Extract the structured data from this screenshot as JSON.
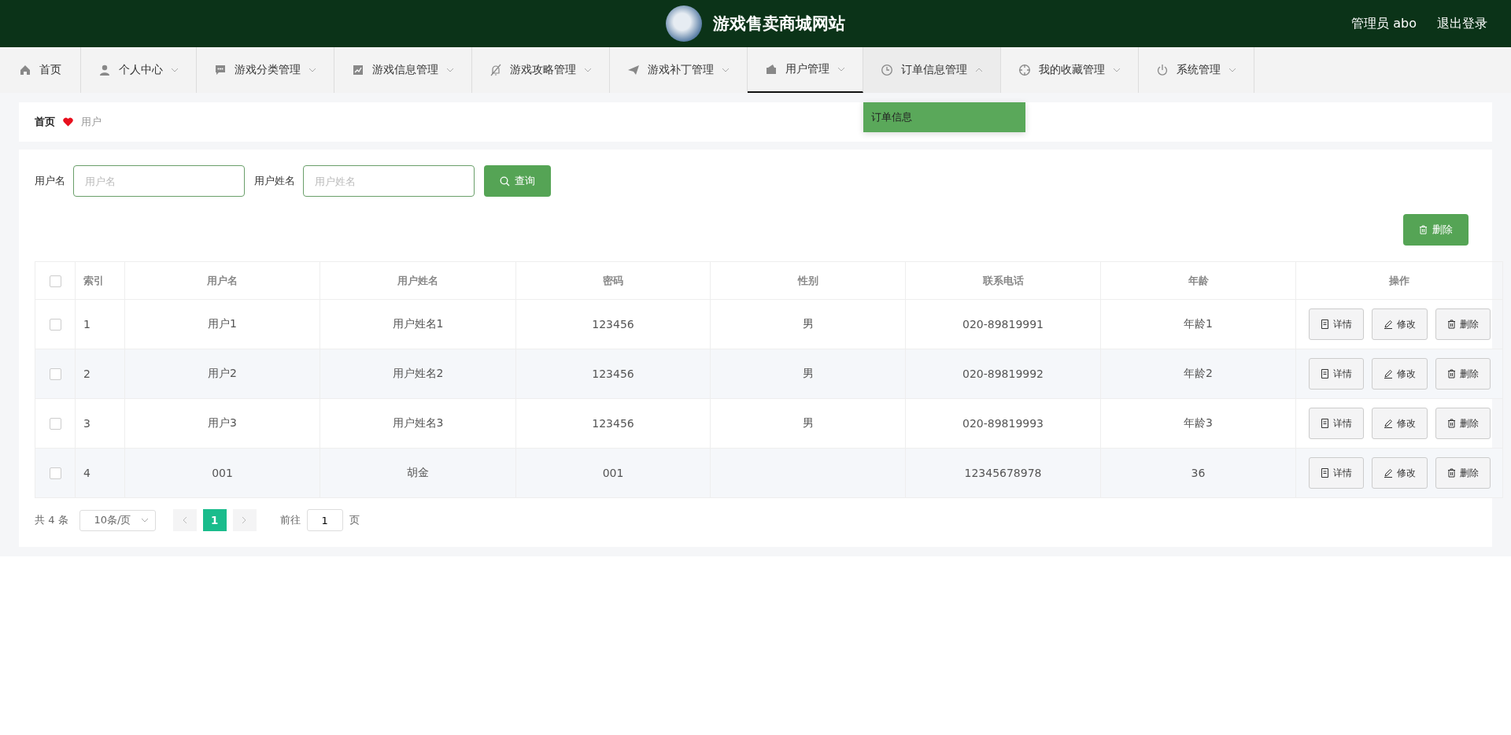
{
  "header": {
    "title": "游戏售卖商城网站",
    "user": "管理员 abo",
    "logout": "退出登录"
  },
  "nav": [
    {
      "label": "首页",
      "kind": "link",
      "selected": false
    },
    {
      "label": "个人中心",
      "kind": "dropdown",
      "selected": false,
      "expanded": false
    },
    {
      "label": "游戏分类管理",
      "kind": "dropdown",
      "selected": false,
      "expanded": false
    },
    {
      "label": "游戏信息管理",
      "kind": "dropdown",
      "selected": false,
      "expanded": false
    },
    {
      "label": "游戏攻略管理",
      "kind": "dropdown",
      "selected": false,
      "expanded": false
    },
    {
      "label": "游戏补丁管理",
      "kind": "dropdown",
      "selected": false,
      "expanded": false
    },
    {
      "label": "用户管理",
      "kind": "dropdown",
      "selected": true,
      "expanded": false
    },
    {
      "label": "订单信息管理",
      "kind": "dropdown",
      "selected": false,
      "expanded": true,
      "submenu": [
        "订单信息"
      ]
    },
    {
      "label": "我的收藏管理",
      "kind": "dropdown",
      "selected": false,
      "expanded": false
    },
    {
      "label": "系统管理",
      "kind": "dropdown",
      "selected": false,
      "expanded": false
    }
  ],
  "breadcrumb": [
    "首页",
    "用户"
  ],
  "search": {
    "fields": [
      {
        "label": "用户名",
        "placeholder": "用户名"
      },
      {
        "label": "用户姓名",
        "placeholder": "用户姓名"
      }
    ],
    "button": "查询"
  },
  "delete_button": "删除",
  "table": {
    "all_checked": false,
    "columns": [
      "索引",
      "用户名",
      "用户姓名",
      "密码",
      "性别",
      "联系电话",
      "年龄",
      "操作"
    ],
    "rows": [
      {
        "checked": false,
        "cells": [
          "1",
          "用户1",
          "用户姓名1",
          "123456",
          "男",
          "020-89819991",
          "年龄1"
        ],
        "actions": [
          "详情",
          "修改",
          "删除"
        ]
      },
      {
        "checked": false,
        "cells": [
          "2",
          "用户2",
          "用户姓名2",
          "123456",
          "男",
          "020-89819992",
          "年龄2"
        ],
        "actions": [
          "详情",
          "修改",
          "删除"
        ]
      },
      {
        "checked": false,
        "cells": [
          "3",
          "用户3",
          "用户姓名3",
          "123456",
          "男",
          "020-89819993",
          "年龄3"
        ],
        "actions": [
          "详情",
          "修改",
          "删除"
        ]
      },
      {
        "checked": false,
        "cells": [
          "4",
          "001",
          "胡金",
          "001",
          "",
          "12345678978",
          "36"
        ],
        "actions": [
          "详情",
          "修改",
          "删除"
        ]
      }
    ]
  },
  "pagination": {
    "total": "共 4 条",
    "page_size": "10条/页",
    "pages": [
      {
        "label": "1",
        "selected": true
      }
    ],
    "goto_label": "前往",
    "goto_value": "1",
    "goto_suffix": "页"
  }
}
